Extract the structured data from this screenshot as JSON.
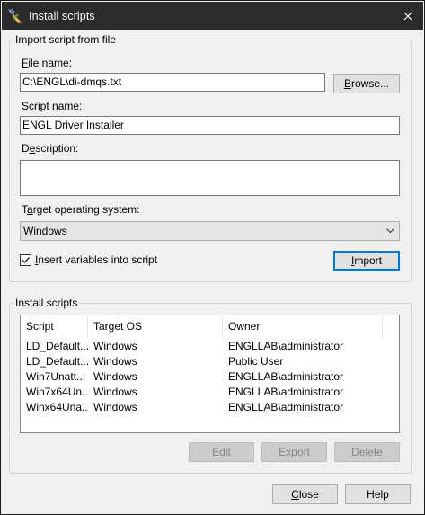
{
  "window": {
    "title": "Install scripts",
    "icon": "install-scripts-icon",
    "close_icon": "close-icon"
  },
  "import_group": {
    "title": "Import script from file",
    "file_name_label_u": "F",
    "file_name_label_rest": "ile name:",
    "file_name_value": "C:\\ENGL\\di-dmqs.txt",
    "browse_button_u": "B",
    "browse_button_rest": "rowse...",
    "script_name_label_u": "S",
    "script_name_label_rest": "cript name:",
    "script_name_value": "ENGL Driver Installer",
    "description_label_pre": "D",
    "description_label_u": "e",
    "description_label_rest": "scription:",
    "description_value": "",
    "target_os_label_pre": "T",
    "target_os_label_u": "a",
    "target_os_label_rest": "rget operating system:",
    "target_os_value": "Windows",
    "insert_vars_checked": true,
    "insert_vars_label_u": "I",
    "insert_vars_label_rest": "nsert variables into script",
    "import_button_u": "I",
    "import_button_rest": "mport"
  },
  "install_group": {
    "title": "Install scripts",
    "columns": [
      "Script",
      "Target OS",
      "Owner"
    ],
    "rows": [
      {
        "script": "LD_Default...",
        "os": "Windows",
        "owner": "ENGLLAB\\administrator"
      },
      {
        "script": "LD_Default...",
        "os": "Windows",
        "owner": "Public User"
      },
      {
        "script": "Win7Unatt...",
        "os": "Windows",
        "owner": "ENGLLAB\\administrator"
      },
      {
        "script": "Win7x64Un...",
        "os": "Windows",
        "owner": "ENGLLAB\\administrator"
      },
      {
        "script": "Winx64Una...",
        "os": "Windows",
        "owner": "ENGLLAB\\administrator"
      }
    ],
    "edit_button_u": "E",
    "edit_button_rest": "dit",
    "export_button_pre": "E",
    "export_button_u": "x",
    "export_button_rest": "port",
    "delete_button_u": "D",
    "delete_button_rest": "elete"
  },
  "footer": {
    "close_button_u": "C",
    "close_button_rest": "lose",
    "help_button": "Help"
  },
  "colors": {
    "titlebar": "#2b2b2b",
    "dialog_bg": "#f0f0f0",
    "focus_border": "#0078d7"
  }
}
